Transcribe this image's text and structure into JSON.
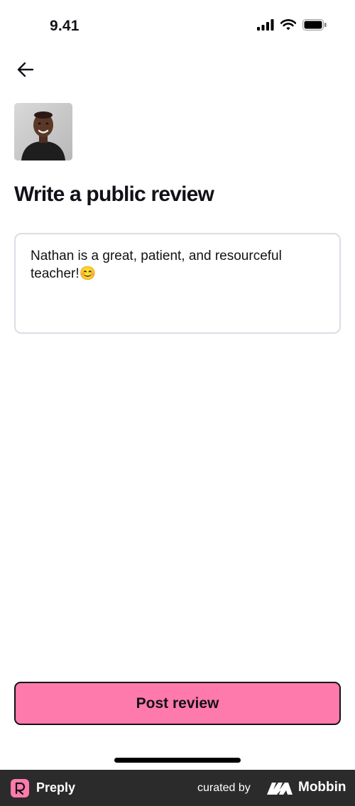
{
  "status_bar": {
    "time": "9.41",
    "icons": [
      "signal-icon",
      "wifi-icon",
      "battery-icon"
    ]
  },
  "header": {
    "back_icon": "arrow-left-icon"
  },
  "tutor": {
    "avatar": "tutor-photo"
  },
  "page": {
    "title": "Write a public review"
  },
  "review": {
    "value": "Nathan is a great, patient, and resourceful teacher!😊"
  },
  "actions": {
    "post_label": "Post review"
  },
  "footer": {
    "app_name": "Preply",
    "curated_by": "curated by",
    "brand": "Mobbin"
  },
  "colors": {
    "accent": "#ff7aac",
    "text": "#121117",
    "border": "#dcdce5",
    "footer_bg": "#2b2b2b"
  }
}
